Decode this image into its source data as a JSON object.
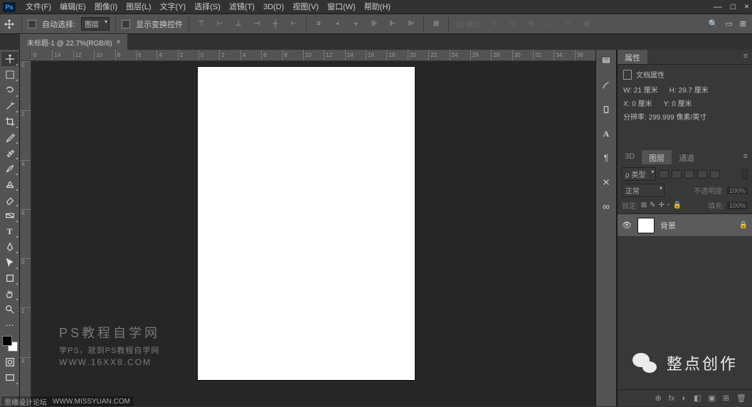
{
  "menubar": {
    "items": [
      "文件(F)",
      "编辑(E)",
      "图像(I)",
      "图层(L)",
      "文字(Y)",
      "选择(S)",
      "滤镜(T)",
      "3D(D)",
      "视图(V)",
      "窗口(W)",
      "帮助(H)"
    ]
  },
  "window_controls": {
    "min": "—",
    "max": "□",
    "close": "×"
  },
  "optionsbar": {
    "auto_select_label": "自动选择:",
    "auto_select_value": "图层",
    "show_transform_label": "显示变换控件",
    "mode3d_label": "3D 模式:"
  },
  "tab": {
    "title": "未标题-1 @ 22.7%(RGB/8)",
    "close": "×"
  },
  "ruler_h": [
    "8",
    "14",
    "12",
    "10",
    "8",
    "6",
    "4",
    "2",
    "0",
    "2",
    "4",
    "6",
    "8",
    "10",
    "12",
    "14",
    "16",
    "18",
    "20",
    "22",
    "24",
    "26",
    "28",
    "30",
    "32",
    "34",
    "36"
  ],
  "ruler_v": [
    "0",
    "2",
    "4",
    "6",
    "0",
    "2",
    "4"
  ],
  "properties": {
    "tab_label": "属性",
    "doc_props_label": "文档属性",
    "w_label": "W:",
    "w_val": "21 厘米",
    "h_label": "H:",
    "h_val": "29.7 厘米",
    "x_label": "X:",
    "x_val": "0 厘米",
    "y_label": "Y:",
    "y_val": "0 厘米",
    "res_label": "分辨率:",
    "res_val": "299.999 像素/英寸"
  },
  "layers_panel": {
    "tabs": [
      "3D",
      "图层",
      "通道"
    ],
    "kind_label": "ρ 类型",
    "blend_mode": "正常",
    "opacity_label": "不透明度:",
    "opacity_val": "100%",
    "lock_label": "锁定:",
    "fill_label": "填充:",
    "fill_val": "100%",
    "layer_name": "背景"
  },
  "watermark": {
    "line1": "PS教程自学网",
    "line2": "学PS，就到PS教程自学网",
    "line3": "WWW.16XX8.COM"
  },
  "bottom_wm": {
    "a": "思缘设计论坛",
    "b": "WWW.MISSYUAN.COM"
  },
  "wechat": {
    "label": "整点创作"
  },
  "right_search": "🔍",
  "layers_footer_icons": [
    "⊕",
    "fx",
    "◐",
    "◧",
    "▣",
    "⊞",
    "🗑"
  ]
}
